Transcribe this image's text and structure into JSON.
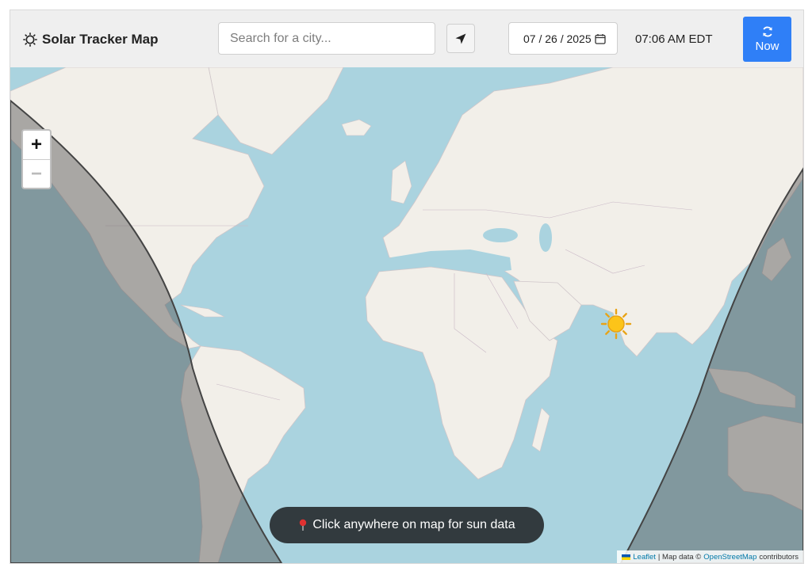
{
  "app": {
    "title": "Solar Tracker Map"
  },
  "search": {
    "placeholder": "Search for a city...",
    "value": ""
  },
  "date": {
    "value": "07 / 26 / 2025"
  },
  "time": {
    "value": "07:06 AM EDT"
  },
  "now_button": {
    "label": "Now"
  },
  "zoom": {
    "in_label": "+",
    "out_label": "−"
  },
  "hint": {
    "label": "Click anywhere on map for sun data"
  },
  "attribution": {
    "leaflet": "Leaflet",
    "separator": " | Map data © ",
    "osm": "OpenStreetMap",
    "suffix": " contributors"
  },
  "colors": {
    "accent": "#2f7ff7",
    "ocean": "#aad3df",
    "land": "#f2efe9",
    "night": "rgba(80,80,80,0.45)"
  },
  "icons": {
    "brand": "sun-outline-icon",
    "locate": "location-arrow-icon",
    "calendar": "calendar-icon",
    "refresh": "refresh-icon",
    "sun_marker": "sun-icon",
    "hint": "pin-icon"
  }
}
